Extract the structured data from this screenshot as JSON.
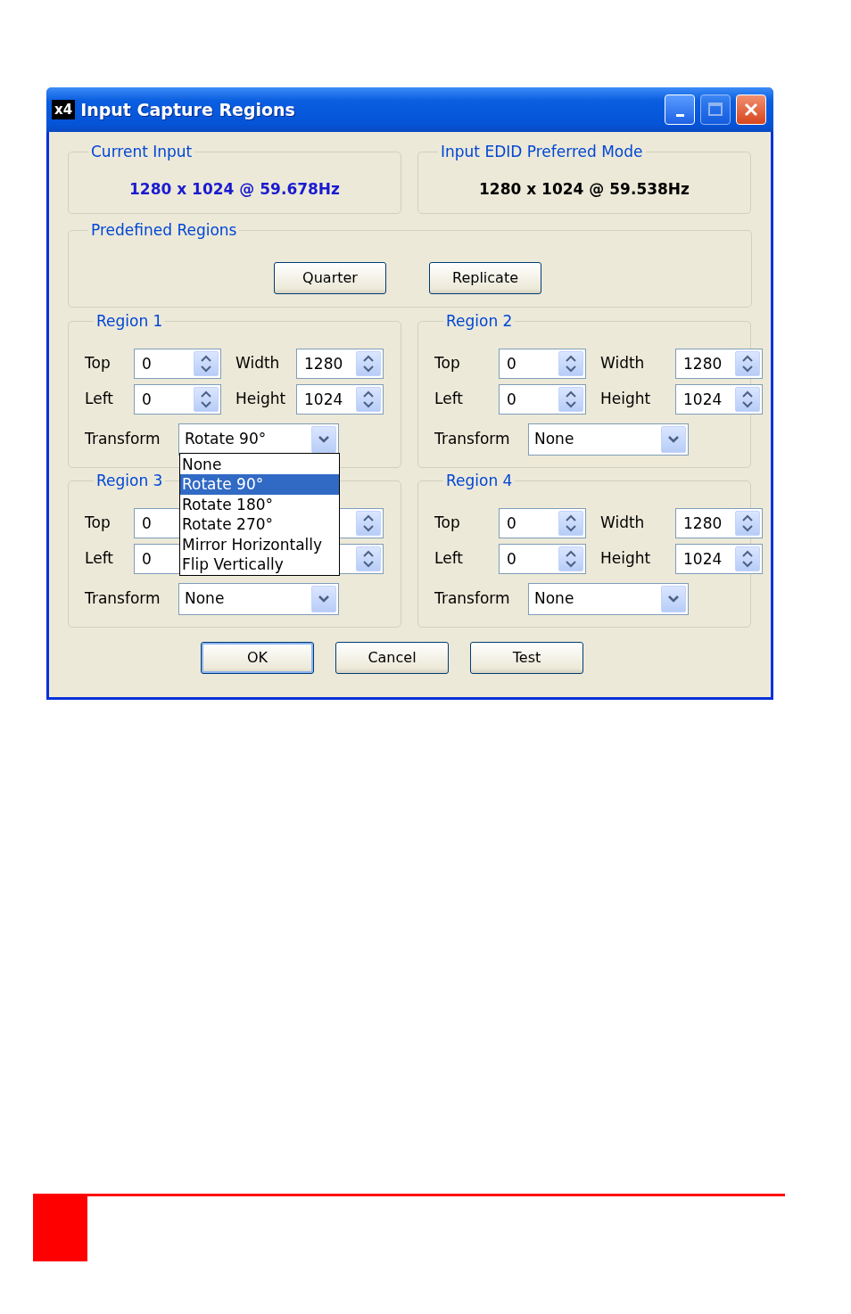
{
  "window": {
    "app_icon": "x4",
    "title": "Input Capture Regions"
  },
  "current_input": {
    "label": "Current Input",
    "value": "1280 x 1024 @ 59.678Hz"
  },
  "preferred_mode": {
    "label": "Input EDID Preferred Mode",
    "value": "1280 x 1024 @ 59.538Hz"
  },
  "predefined": {
    "label": "Predefined Regions",
    "buttons": [
      "Quarter",
      "Replicate"
    ]
  },
  "regions": [
    {
      "title": "Region 1",
      "fields": [
        {
          "kind": "spin",
          "label": "Top",
          "value": "0"
        },
        {
          "kind": "spin",
          "label": "Width",
          "value": "1280"
        },
        {
          "kind": "spin",
          "label": "Left",
          "value": "0"
        },
        {
          "kind": "spin",
          "label": "Height",
          "value": "1024"
        }
      ],
      "transform": {
        "label": "Transform",
        "value": "Rotate 90°",
        "options": [
          {
            "label": "None",
            "selected": false
          },
          {
            "label": "Rotate 90°",
            "selected": true
          },
          {
            "label": "Rotate 180°",
            "selected": false
          },
          {
            "label": "Rotate 270°",
            "selected": false
          },
          {
            "label": "Mirror Horizontally",
            "selected": false
          },
          {
            "label": "Flip Vertically",
            "selected": false
          }
        ]
      }
    },
    {
      "title": "Region 2",
      "fields": [
        {
          "kind": "spin",
          "label": "Top",
          "value": "0"
        },
        {
          "kind": "spin",
          "label": "Width",
          "value": "1280"
        },
        {
          "kind": "spin",
          "label": "Left",
          "value": "0"
        },
        {
          "kind": "spin",
          "label": "Height",
          "value": "1024"
        }
      ],
      "transform": {
        "label": "Transform",
        "value": "None"
      }
    },
    {
      "title": "Region 3",
      "fields": [
        {
          "kind": "value",
          "label": "Top",
          "value": "0"
        },
        {
          "kind": "covered"
        },
        {
          "kind": "value",
          "label": "Left",
          "value": "0"
        },
        {
          "kind": "covered"
        }
      ],
      "transform": {
        "label": "Transform",
        "value": "None"
      }
    },
    {
      "title": "Region 4",
      "fields": [
        {
          "kind": "spin",
          "label": "Top",
          "value": "0"
        },
        {
          "kind": "spin",
          "label": "Width",
          "value": "1280"
        },
        {
          "kind": "spin",
          "label": "Left",
          "value": "0"
        },
        {
          "kind": "spin",
          "label": "Height",
          "value": "1024"
        }
      ],
      "transform": {
        "label": "Transform",
        "value": "None"
      }
    }
  ],
  "buttons": [
    {
      "label": "OK",
      "default": true
    },
    {
      "label": "Cancel",
      "default": false
    },
    {
      "label": "Test",
      "default": false
    }
  ]
}
